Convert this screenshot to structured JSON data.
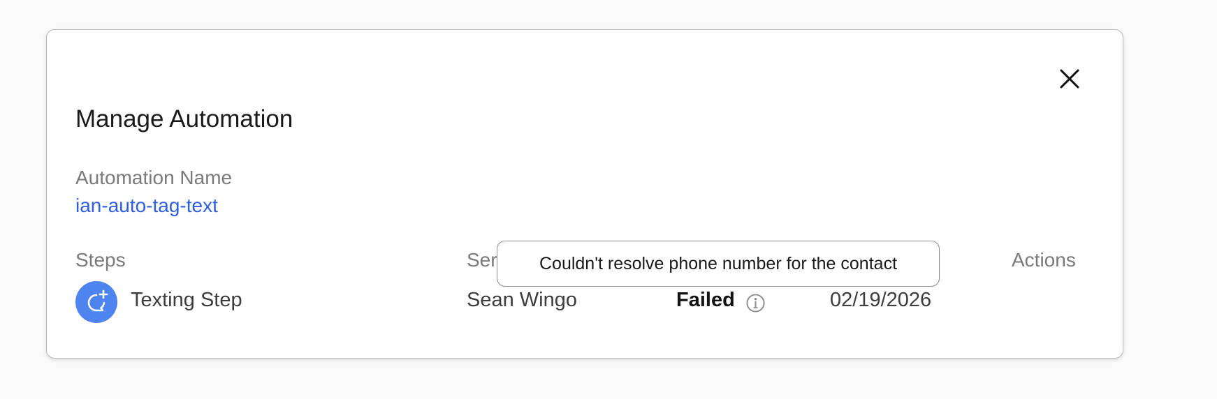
{
  "modal": {
    "title": "Manage Automation",
    "close_icon": "close-icon"
  },
  "automation": {
    "label": "Automation Name",
    "name": "ian-auto-tag-text",
    "link_color": "#2f5fde"
  },
  "table": {
    "headers": {
      "steps": "Steps",
      "sent_partial": "Ser",
      "actions": "Actions"
    },
    "rows": [
      {
        "icon": "chat-add-icon",
        "icon_color": "#4d84f0",
        "step": "Texting Step",
        "person": "Sean Wingo",
        "status": "Failed",
        "status_info_icon": "info-icon",
        "date": "02/19/2026"
      }
    ]
  },
  "tooltip": {
    "text": "Couldn't resolve phone number for the contact"
  }
}
